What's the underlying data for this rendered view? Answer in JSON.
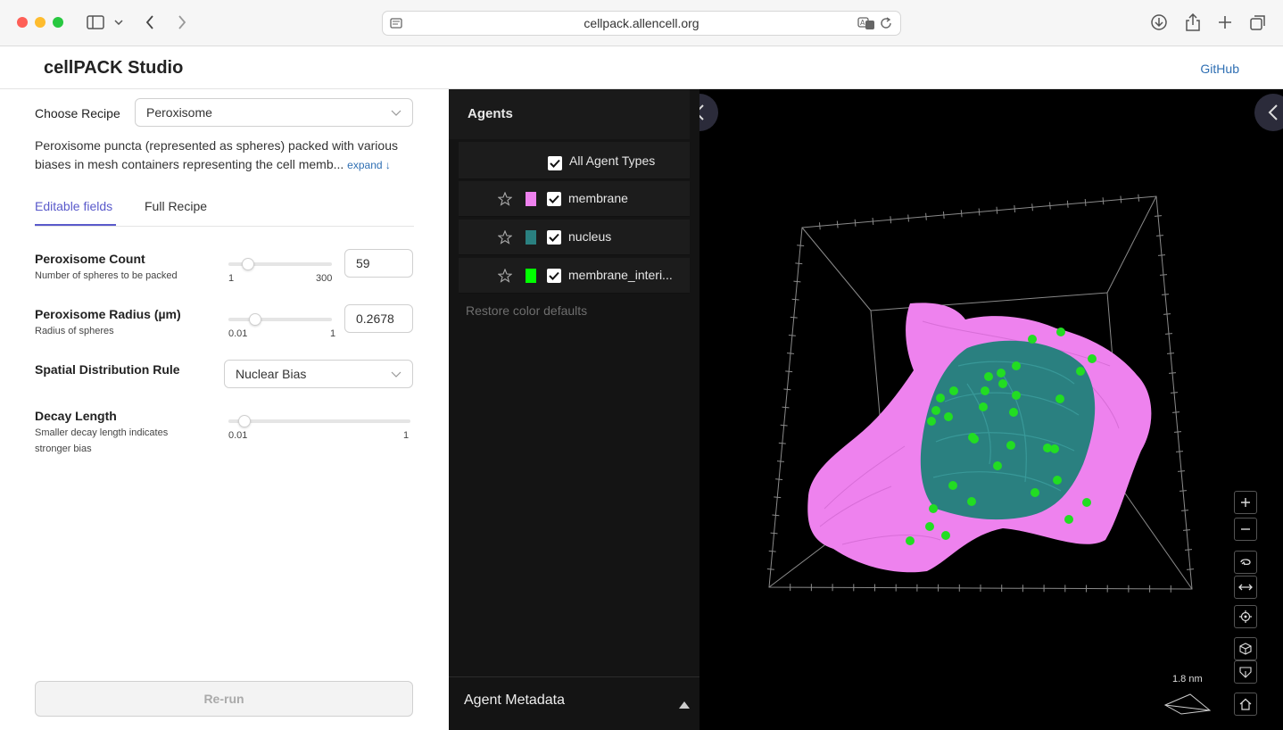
{
  "browser": {
    "url": "cellpack.allencell.org"
  },
  "app": {
    "title": "cellPACK Studio",
    "github_label": "GitHub"
  },
  "recipe": {
    "label": "Choose Recipe",
    "selected": "Peroxisome",
    "description": "Peroxisome puncta (represented as spheres) packed with various biases in mesh containers representing the cell memb...",
    "expand_label": "expand ↓"
  },
  "tabs": [
    {
      "label": "Editable fields",
      "active": true
    },
    {
      "label": "Full Recipe",
      "active": false
    }
  ],
  "fields": {
    "count": {
      "title": "Peroxisome Count",
      "subtitle": "Number of spheres to be packed",
      "min": "1",
      "max": "300",
      "value": "59",
      "fraction": 0.194
    },
    "radius": {
      "title": "Peroxisome Radius (µm)",
      "subtitle": "Radius of spheres",
      "min": "0.01",
      "max": "1",
      "value": "0.2678",
      "fraction": 0.26
    },
    "distribution": {
      "title": "Spatial Distribution Rule",
      "selected": "Nuclear Bias"
    },
    "decay": {
      "title": "Decay Length",
      "subtitle": "Smaller decay length indicates stronger bias",
      "min": "0.01",
      "max": "1",
      "fraction": 0.05
    }
  },
  "rerun_label": "Re-run",
  "agents": {
    "title": "Agents",
    "all_label": "All Agent Types",
    "items": [
      {
        "label": "membrane",
        "color": "#ee82ee",
        "checked": true
      },
      {
        "label": "nucleus",
        "color": "#2a8080",
        "checked": true
      },
      {
        "label": "membrane_interi...",
        "color": "#00ff00",
        "checked": true
      }
    ],
    "restore_label": "Restore color defaults",
    "metadata_label": "Agent Metadata"
  },
  "viewer": {
    "scale_label": "1.8 nm"
  },
  "colors": {
    "accent": "#5a5acb",
    "link": "#2f6fb3",
    "membrane": "#ee82ee",
    "nucleus": "#2a8080",
    "peroxisome": "#22dd22"
  }
}
